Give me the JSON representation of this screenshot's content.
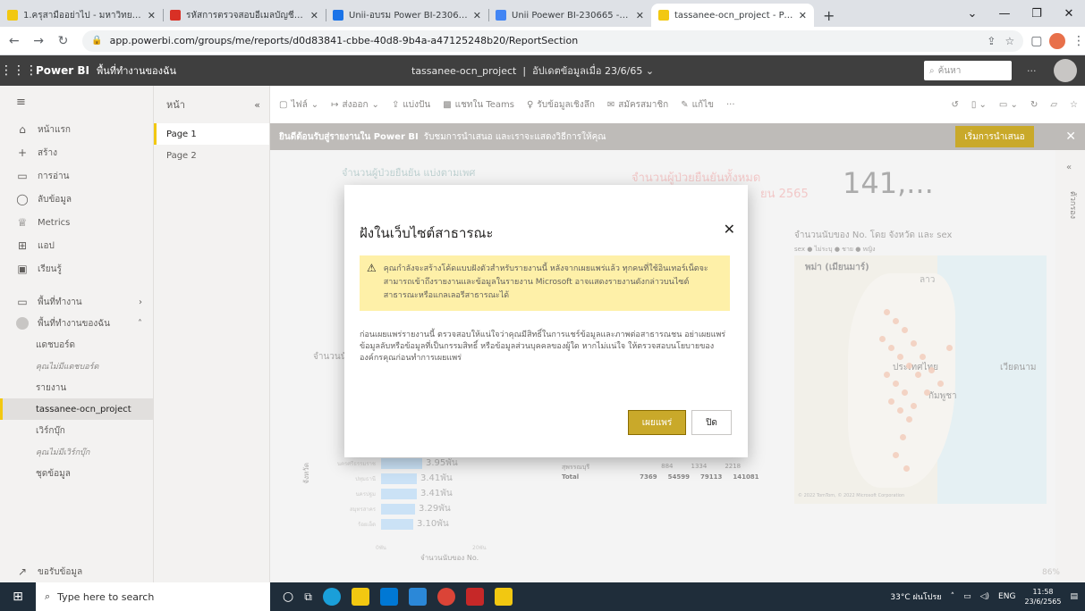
{
  "browser": {
    "tabs": [
      {
        "title": "1.ครุสามืออย่าไป - มหาวิทยาลัยอุบล",
        "color": "#f2c811",
        "active": false
      },
      {
        "title": "รหัสการตรวจสอบอีเมลบัญชี Ubon Ra",
        "color": "#d93025",
        "active": false
      },
      {
        "title": "Unii-อบรม Power BI-2306665 - Go",
        "color": "#1a73e8",
        "active": false
      },
      {
        "title": "Unii Poewer BI-230665 - Google",
        "color": "#4285f4",
        "active": false
      },
      {
        "title": "tassanee-ocn_project - Power BI",
        "color": "#f2c811",
        "active": true
      }
    ],
    "url": "app.powerbi.com/groups/me/reports/d0d83841-cbbe-40d8-9b4a-a47125248b20/ReportSection"
  },
  "header": {
    "brand": "Power BI",
    "workspace": "พื้นที่ทำงานของฉัน",
    "report_title": "tassanee-ocn_project",
    "updated": "อัปเดตข้อมูลเมื่อ 23/6/65",
    "search_placeholder": "ค้นหา"
  },
  "leftnav": {
    "items": [
      {
        "icon": "⌂",
        "label": "หน้าแรก"
      },
      {
        "icon": "+",
        "label": "สร้าง"
      },
      {
        "icon": "▭",
        "label": "การอ่าน"
      },
      {
        "icon": "◯",
        "label": "ลับข้อมูล"
      },
      {
        "icon": "♕",
        "label": "Metrics"
      },
      {
        "icon": "⊞",
        "label": "แอป"
      },
      {
        "icon": "▣",
        "label": "เรียนรู้"
      }
    ],
    "workspaces": "พื้นที่ทำงาน",
    "my_workspace": "พื้นที่ทำงานของฉัน",
    "sub": [
      {
        "label": "แดชบอร์ด",
        "style": ""
      },
      {
        "label": "คุณไม่มีแดชบอร์ด",
        "style": "small"
      },
      {
        "label": "รายงาน",
        "style": ""
      },
      {
        "label": "tassanee-ocn_project",
        "style": "active"
      },
      {
        "label": "เวิร์กบุ๊ก",
        "style": ""
      },
      {
        "label": "คุณไม่มีเวิร์กบุ๊ก",
        "style": "small"
      },
      {
        "label": "ชุดข้อมูล",
        "style": ""
      }
    ],
    "get_data": "ขอรับข้อมูล"
  },
  "pages": {
    "header": "หน้า",
    "items": [
      "Page 1",
      "Page 2"
    ]
  },
  "actionbar": {
    "file": "ไฟล์",
    "export": "ส่งออก",
    "share": "แบ่งปัน",
    "teams": "แชทใน Teams",
    "insights": "รับข้อมูลเชิงลึก",
    "subscribe": "สมัครสมาชิก",
    "edit": "แก้ไข"
  },
  "banner": {
    "bold": "ยินดีต้อนรับสู่รายงานใน Power BI",
    "text": "รับชมการนำเสนอ และเราจะแสดงวิธีการให้คุณ",
    "button": "เริ่มการนำเสนอ"
  },
  "canvas": {
    "chart1_title": "จำนวนผู้ป่วยยืนยัน แบ่งตามเพศ",
    "chart2_title": "จำนวนผู้ป่วยยืนยันทั้งหมด",
    "chart2_sub": "ยน 2565",
    "kpi": "141,...",
    "map_title": "จำนวนนับของ No. โดย จังหวัด และ sex",
    "map_legend": "sex ● ไม่ระบุ ● ชาย ● หญิง",
    "side_label1": "จำนวนนั",
    "bar_axis_label": "จังหวัด",
    "bars": [
      {
        "label": "นครศรีธรรมราช",
        "value": "3.95พัน",
        "w": 46
      },
      {
        "label": "ปทุมธานี",
        "value": "3.41พัน",
        "w": 40
      },
      {
        "label": "นครปฐม",
        "value": "3.41พัน",
        "w": 40
      },
      {
        "label": "สมุทรสาคร",
        "value": "3.29พัน",
        "w": 38
      },
      {
        "label": "ร้อยเอ็ด",
        "value": "3.10พัน",
        "w": 36
      }
    ],
    "bar_xaxis": [
      "0พัน",
      "20พัน"
    ],
    "bar_xlabel": "จำนวนนับของ No.",
    "table_row": [
      "สุพรรณบุรี",
      "884",
      "1334",
      "2218"
    ],
    "table_total": [
      "Total",
      "7369",
      "54599",
      "79113",
      "141081"
    ],
    "map_labels": [
      "พม่า (เมียนมาร์)",
      "ลาว",
      "ประเทศไทย",
      "กัมพูชา",
      "เวียดนาม"
    ],
    "map_attrib": "© 2022 TomTom, © 2022 Microsoft Corporation",
    "zoom": "86%"
  },
  "rightrail": {
    "label": "ตัวกรอง"
  },
  "modal": {
    "title": "ฝังในเว็บไซต์สาธารณะ",
    "warning": "คุณกำลังจะสร้างโค้ดแบบฝังตัวสำหรับรายงานนี้ หลังจากเผยแพร่แล้ว ทุกคนที่ใช้อินเทอร์เน็ตจะสามารถเข้าถึงรายงานและข้อมูลในรายงาน Microsoft อาจแสดงรายงานดังกล่าวบนไซต์สาธารณะหรือแกลเลอรีสาธารณะได้",
    "body": "ก่อนเผยแพร่รายงานนี้ ตรวจสอบให้แน่ใจว่าคุณมีสิทธิ์ในการแชร์ข้อมูลและภาพต่อสาธารณชน อย่าเผยแพร่ข้อมูลลับหรือข้อมูลที่เป็นกรรมสิทธิ์ หรือข้อมูลส่วนบุคคลของผู้ใด หากไม่แน่ใจ ให้ตรวจสอบนโยบายขององค์กรคุณก่อนทำการเผยแพร่",
    "publish": "เผยแพร่",
    "close": "ปิด"
  },
  "taskbar": {
    "search": "Type here to search",
    "weather": "33°C ฝนโปรย",
    "lang": "ENG",
    "time": "11:58",
    "date": "23/6/2565"
  }
}
